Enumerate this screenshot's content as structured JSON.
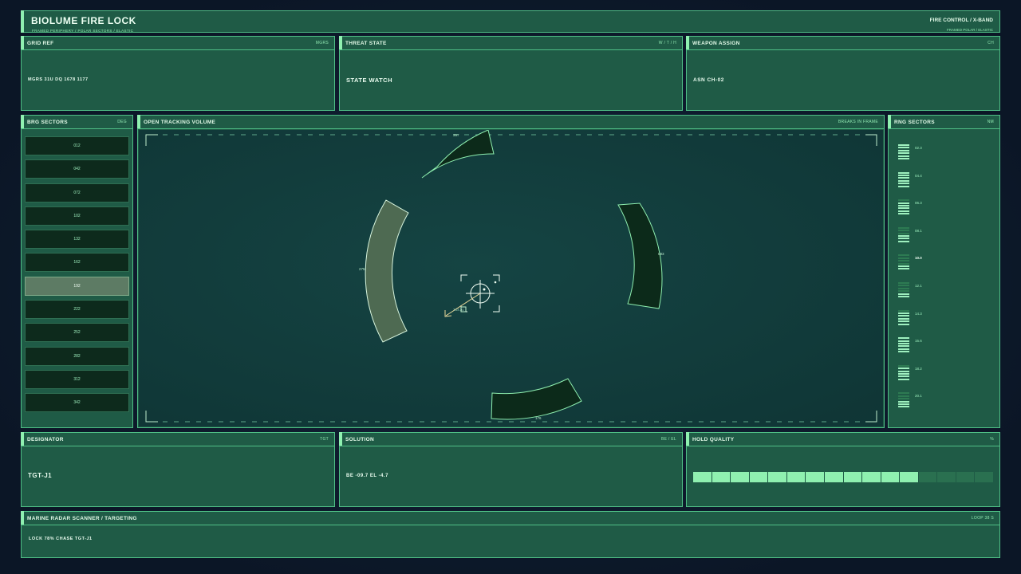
{
  "header": {
    "title": "BIOLUME FIRE LOCK",
    "subtitle": "FRAMED PERIPHERY  /  POLAR SECTORS  /  ELASTIC",
    "mode": "FIRE CONTROL  /  X-BAND",
    "mode_sub": "FRAMED  POLAR / ELASTIC"
  },
  "grid_ref": {
    "title": "GRID REF",
    "unit": "MGRS",
    "value": "MGRS  31U DQ 1678 1177"
  },
  "threat_state": {
    "title": "THREAT STATE",
    "unit": "W / T / H",
    "value": "STATE  WATCH"
  },
  "weapon_assign": {
    "title": "WEAPON ASSIGN",
    "unit": "CH",
    "value": "ASN  CH-02"
  },
  "brg_sectors": {
    "title": "BRG SECTORS",
    "unit": "DEG",
    "items": [
      "012",
      "042",
      "072",
      "102",
      "132",
      "162",
      "192",
      "222",
      "252",
      "282",
      "312",
      "342"
    ],
    "active_index": 6
  },
  "tracking": {
    "title": "OPEN TRACKING VOLUME",
    "status": "BREAKS IN FRAME",
    "bearing_top": "357",
    "bearing_right": "083",
    "bearing_bottom": "176",
    "bearing_left": "275",
    "reticle_label": "TGT-J1"
  },
  "rng_sectors": {
    "title": "RNG SECTORS",
    "unit": "NM",
    "items": [
      {
        "label": "02.3",
        "level": 6
      },
      {
        "label": "04.4",
        "level": 6
      },
      {
        "label": "06.3",
        "level": 5
      },
      {
        "label": "08.1",
        "level": 3
      },
      {
        "label": "10.0",
        "level": 2,
        "selected": true
      },
      {
        "label": "12.1",
        "level": 2
      },
      {
        "label": "14.3",
        "level": 5
      },
      {
        "label": "15.6",
        "level": 6
      },
      {
        "label": "18.2",
        "level": 5
      },
      {
        "label": "20.1",
        "level": 3
      }
    ],
    "max_level": 6
  },
  "designator": {
    "title": "DESIGNATOR",
    "unit": "TGT",
    "value": "TGT-J1"
  },
  "solution": {
    "title": "SOLUTION",
    "unit": "BE / EL",
    "value": "BE -09.7  EL -4.7"
  },
  "hold_quality": {
    "title": "HOLD QUALITY",
    "unit": "%",
    "segments_total": 16,
    "segments_on": 12
  },
  "footer": {
    "title": "MARINE RADAR SCANNER  /  TARGETING",
    "loop": "LOOP 38 S",
    "status": "LOCK 78%  CHASE TGT-J1"
  },
  "colors": {
    "panel": "#1f5b46",
    "border": "#4fbf86",
    "accent": "#8ff0b0",
    "track_bg": "#113a3a",
    "sector_dark": "#0b2416",
    "sector_active": "#4e6a52",
    "reticle": "#f2fff5"
  }
}
